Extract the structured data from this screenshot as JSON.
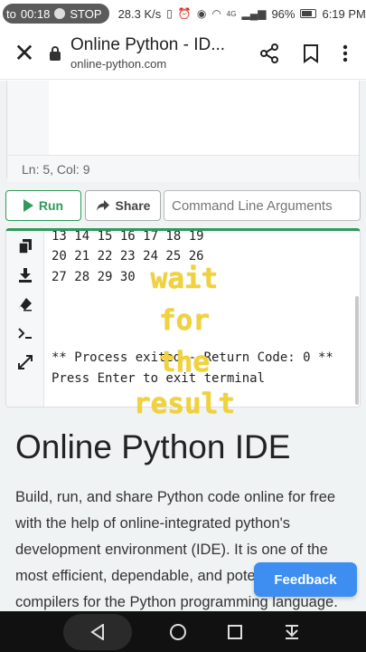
{
  "status_bar": {
    "recording_time": "00:18",
    "recording_prefix": "to",
    "stop_label": "STOP",
    "net_speed": "28.3 K/s",
    "network": "4G",
    "battery": "96%",
    "clock": "6:19 PM"
  },
  "browser": {
    "page_title": "Online Python - ID...",
    "domain": "online-python.com"
  },
  "editor": {
    "cursor_status": "Ln: 5,  Col: 9"
  },
  "run_bar": {
    "run_label": "Run",
    "share_label": "Share",
    "args_placeholder": "Command Line Arguments"
  },
  "terminal": {
    "lines": [
      "13 14 15 16 17 18 19",
      "20 21 22 23 24 25 26",
      "27 28 29 30",
      "** Process exited - Return Code: 0 **",
      "Press Enter to exit terminal"
    ]
  },
  "overlay": {
    "lines": [
      "wait",
      "for",
      "the",
      "result"
    ]
  },
  "article": {
    "title": "Online Python IDE",
    "body": "Build, run, and share Python code online for free with the help of online-integrated python's development environment (IDE). It is one of the most efficient, dependable, and potent online compilers for the Python programming language."
  },
  "feedback_label": "Feedback",
  "colors": {
    "accent_green": "#2e9a5b",
    "feedback_blue": "#3d8ef0",
    "overlay_yellow": "#f1d23a"
  }
}
